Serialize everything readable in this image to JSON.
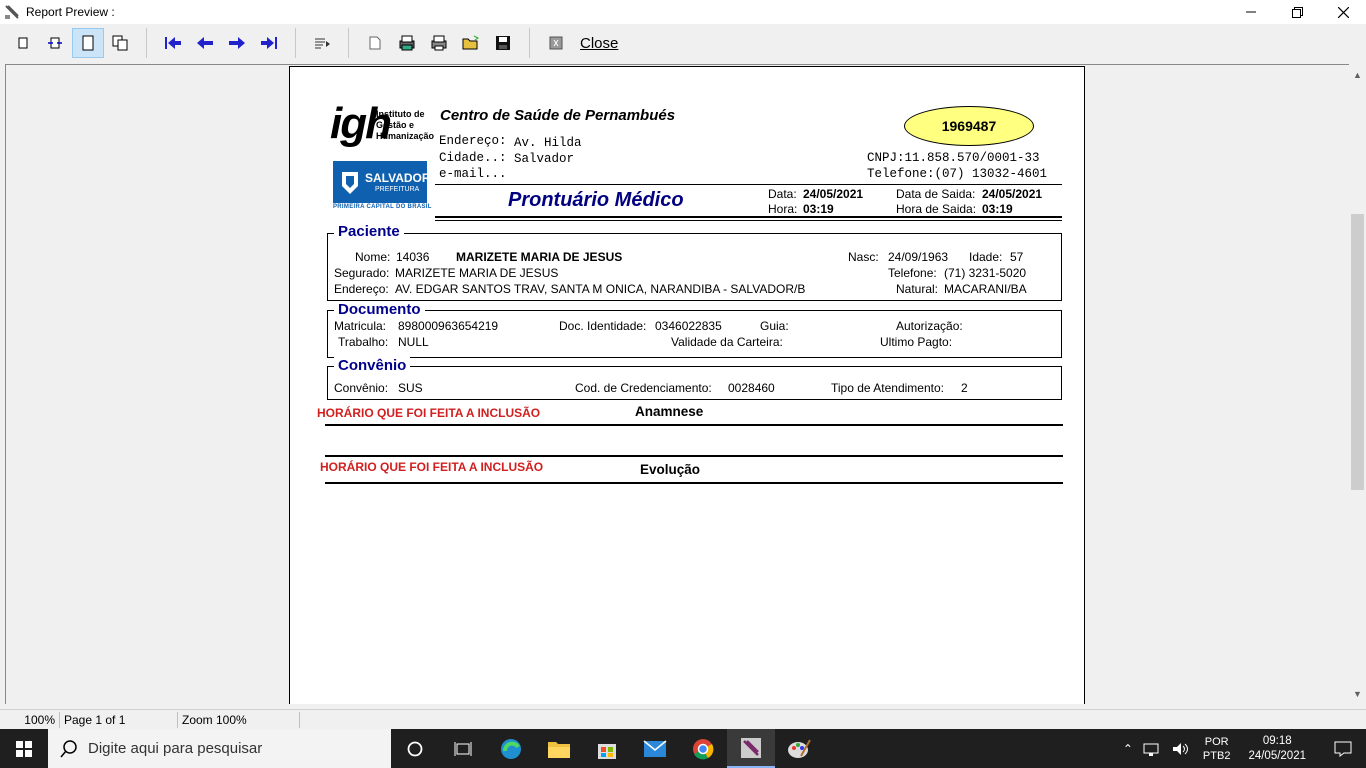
{
  "window": {
    "title": "Report Preview :"
  },
  "toolbar": {
    "close_label": "Close"
  },
  "report": {
    "org_name_line1": "Instituto de",
    "org_name_line2": "Gestão e",
    "org_name_line3": "Humanização",
    "org_logo_text": "igh",
    "city_logo_text": "SALVADOR",
    "city_logo_sub": "PREFEITURA",
    "city_logo_caption": "PRIMEIRA CAPITAL DO BRASIL",
    "unit_name": "Centro de Saúde de Pernambués",
    "address_label": "Endereço:",
    "address_value": "Av. Hilda",
    "city_label": "Cidade..:",
    "city_value": "Salvador",
    "email_label": "e-mail...",
    "record_number": "1969487",
    "cnpj": "CNPJ:11.858.570/0001-33",
    "phone": "Telefone:(07) 13032-4601",
    "doc_title": "Prontuário Médico",
    "date_label": "Data:",
    "date_value": "24/05/2021",
    "time_label": "Hora:",
    "time_value": "03:19",
    "exit_date_label": "Data de Saida:",
    "exit_date_value": "24/05/2021",
    "exit_time_label": "Hora de Saida:",
    "exit_time_value": "03:19",
    "patient": {
      "section_title": "Paciente",
      "name_label": "Nome:",
      "id": "14036",
      "name": "MARIZETE MARIA DE JESUS",
      "birth_label": "Nasc:",
      "birth_value": "24/09/1963",
      "age_label": "Idade:",
      "age_value": "57",
      "insured_label": "Segurado:",
      "insured_value": "MARIZETE MARIA DE JESUS",
      "phone_label": "Telefone:",
      "phone_value": "(71)  3231-5020",
      "address_label": "Endereço:",
      "address_value": "AV. EDGAR SANTOS TRAV, SANTA M ONICA, NARANDIBA - SALVADOR/B",
      "natural_label": "Natural:",
      "natural_value": "MACARANI/BA"
    },
    "document": {
      "section_title": "Documento",
      "enroll_label": "Matricula:",
      "enroll_value": "898000963654219",
      "id_label": "Doc. Identidade:",
      "id_value": "0346022835",
      "guide_label": "Guia:",
      "auth_label": "Autorização:",
      "work_label": "Trabalho:",
      "work_value": "NULL",
      "card_label": "Validade da Carteira:",
      "last_pay_label": "Ultimo Pagto:"
    },
    "agreement": {
      "section_title": "Convênio",
      "agreement_label": "Convênio:",
      "agreement_value": "SUS",
      "cred_label": "Cod. de Credenciamento:",
      "cred_value": "0028460",
      "care_label": "Tipo de Atendimento:",
      "care_value": "2"
    },
    "annotation_1": "HORÁRIO QUE FOI FEITA A INCLUSÃO",
    "anamnese_label": "Anamnese",
    "annotation_2": "HORÁRIO QUE FOI FEITA A INCLUSÃO",
    "evolution_label": "Evolução"
  },
  "statusbar": {
    "zoom_pct": "100%",
    "page": "Page 1 of 1",
    "zoom": "Zoom 100%"
  },
  "taskbar": {
    "search_placeholder": "Digite aqui para pesquisar",
    "lang1": "POR",
    "lang2": "PTB2",
    "time": "09:18",
    "date": "24/05/2021"
  }
}
